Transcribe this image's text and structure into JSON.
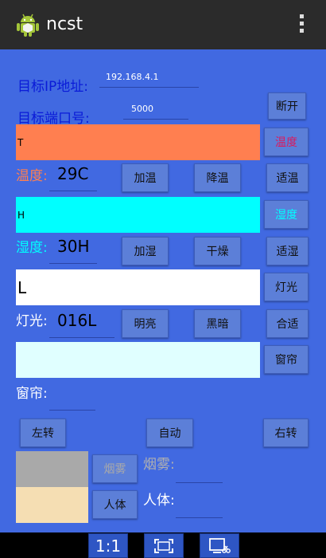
{
  "app": {
    "title": "ncst"
  },
  "connection": {
    "ip_label": "目标IP地址:",
    "ip_value": "192.168.4.1",
    "port_label": "目标端口号:",
    "port_value": "5000",
    "disconnect_label": "断开"
  },
  "temperature": {
    "bar_text": "T",
    "bar_color": "#ff7f50",
    "side_label": "温度",
    "label": "温度:",
    "value": "29C",
    "buttons": [
      "加温",
      "降温",
      "适温"
    ]
  },
  "humidity": {
    "bar_text": "H",
    "bar_color": "#00ffff",
    "side_label": "湿度",
    "label": "湿度:",
    "value": "30H",
    "buttons": [
      "加湿",
      "干燥",
      "适湿"
    ]
  },
  "light": {
    "bar_text": "L",
    "bar_color": "#ffffff",
    "side_label": "灯光",
    "label": "灯光:",
    "value": "016L",
    "buttons": [
      "明亮",
      "黑暗",
      "合适"
    ]
  },
  "curtain": {
    "bar_color": "#e0ffff",
    "side_label": "窗帘",
    "label": "窗帘:",
    "value": "",
    "buttons": [
      "左转",
      "自动",
      "右转"
    ]
  },
  "smoke": {
    "swatch_color": "#a9a9a9",
    "button_label": "烟雾",
    "label": "烟雾:",
    "value": ""
  },
  "human": {
    "swatch_color": "#f5deb3",
    "button_label": "人体",
    "label": "人体:",
    "value": ""
  },
  "navbar": {
    "ratio_label": "1:1"
  },
  "colors": {
    "accent_blue": "#4169e1",
    "temp_label": "#ff7f50",
    "humidity_label": "#00ffff",
    "temp_side_text": "#d81b60"
  }
}
